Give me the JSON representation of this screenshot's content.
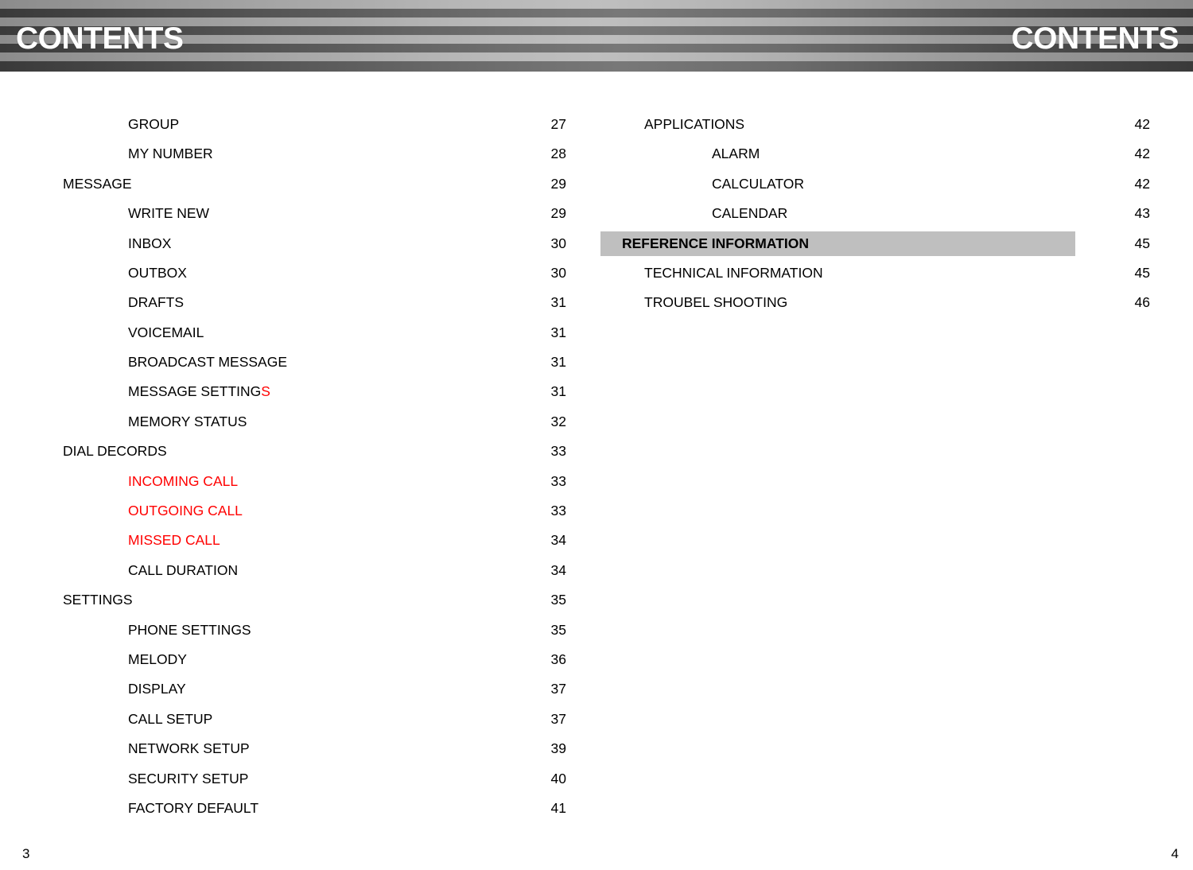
{
  "banner": {
    "title_left": "CONTENTS",
    "title_right": "CONTENTS"
  },
  "colors": {
    "highlight_bar": "#bfbfbf",
    "accent_red": "#ff0000",
    "stripe_dark": "#3a3a3a",
    "stripe_light": "#8c8c8c",
    "text": "#000000"
  },
  "toc": {
    "left_column": [
      {
        "label": "GROUP",
        "page": "27",
        "level": 2,
        "style": "plain"
      },
      {
        "label": "MY NUMBER",
        "page": "28",
        "level": 2,
        "style": "plain"
      },
      {
        "label": "MESSAGE",
        "page": "29",
        "level": 1,
        "style": "plain"
      },
      {
        "label": "WRITE NEW",
        "page": "29",
        "level": 2,
        "style": "plain"
      },
      {
        "label": "INBOX",
        "page": "30",
        "level": 2,
        "style": "plain"
      },
      {
        "label": "OUTBOX",
        "page": "30",
        "level": 2,
        "style": "plain"
      },
      {
        "label": "DRAFTS",
        "page": "31",
        "level": 2,
        "style": "plain"
      },
      {
        "label": "VOICEMAIL",
        "page": "31",
        "level": 2,
        "style": "plain"
      },
      {
        "label": "BROADCAST MESSAGE",
        "page": "31",
        "level": 2,
        "style": "plain"
      },
      {
        "label": "MESSAGE SETTING",
        "label_suffix_red": "S",
        "page": "31",
        "level": 2,
        "style": "partial-red"
      },
      {
        "label": "MEMORY STATUS",
        "page": "32",
        "level": 2,
        "style": "plain"
      },
      {
        "label": "DIAL DECORDS",
        "page": "33",
        "level": 1,
        "style": "plain"
      },
      {
        "label": "INCOMING CALL",
        "page": "33",
        "level": 2,
        "style": "red"
      },
      {
        "label": "OUTGOING CALL",
        "page": "33",
        "level": 2,
        "style": "red"
      },
      {
        "label": "MISSED CALL",
        "page": "34",
        "level": 2,
        "style": "red"
      },
      {
        "label": "CALL DURATION",
        "page": "34",
        "level": 2,
        "style": "plain"
      },
      {
        "label": "SETTINGS",
        "page": "35",
        "level": 1,
        "style": "plain"
      },
      {
        "label": "PHONE SETTINGS",
        "page": "35",
        "level": 2,
        "style": "plain"
      },
      {
        "label": "MELODY",
        "page": "36",
        "level": 2,
        "style": "plain"
      },
      {
        "label": "DISPLAY",
        "page": "37",
        "level": 2,
        "style": "plain"
      },
      {
        "label": "CALL SETUP",
        "page": "37",
        "level": 2,
        "style": "plain"
      },
      {
        "label": "NETWORK SETUP",
        "page": "39",
        "level": 2,
        "style": "plain"
      },
      {
        "label": "SECURITY SETUP",
        "page": "40",
        "level": 2,
        "style": "plain"
      },
      {
        "label": "FACTORY DEFAULT",
        "page": "41",
        "level": 2,
        "style": "plain"
      }
    ],
    "right_column": [
      {
        "label": "APPLICATIONS",
        "page": "42",
        "level": 1,
        "style": "plain"
      },
      {
        "label": "ALARM",
        "page": "42",
        "level": 2,
        "style": "plain"
      },
      {
        "label": "CALCULATOR",
        "page": "42",
        "level": 2,
        "style": "plain"
      },
      {
        "label": "CALENDAR",
        "page": "43",
        "level": 2,
        "style": "plain"
      },
      {
        "label": "REFERENCE INFORMATION",
        "page": "45",
        "level": 0,
        "style": "bold-highlight"
      },
      {
        "label": "TECHNICAL INFORMATION",
        "page": "45",
        "level": 1,
        "style": "plain"
      },
      {
        "label": "TROUBEL SHOOTING",
        "page": "46",
        "level": 1,
        "style": "plain"
      }
    ]
  },
  "footer": {
    "page_left": "3",
    "page_right": "4"
  }
}
